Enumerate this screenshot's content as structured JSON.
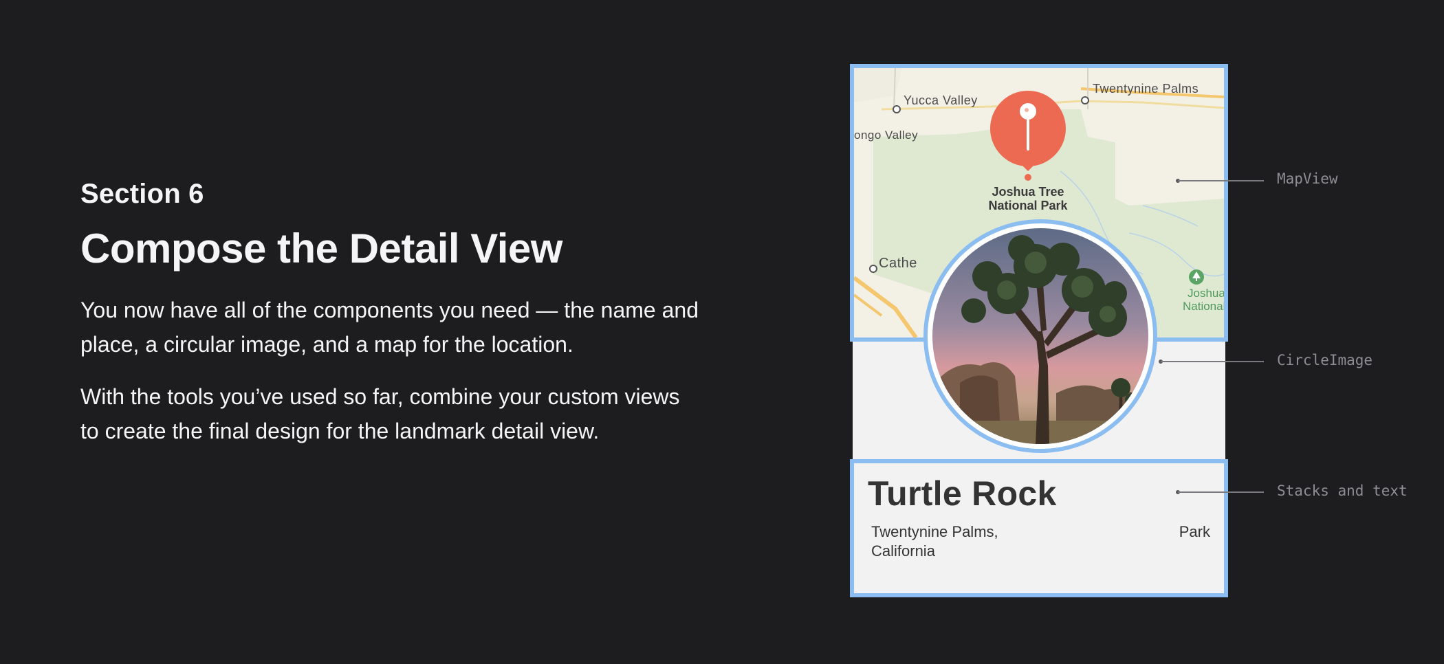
{
  "intro": {
    "section": "Section 6",
    "title": "Compose the Detail View",
    "paragraph_1": "You now have all of the components you need — the name and place, a circular image, and a map for the location.",
    "paragraph_2": "With the tools you’ve used so far, combine your custom views to create the final design for the landmark detail view."
  },
  "map": {
    "labels": {
      "yucca_valley": "Yucca Valley",
      "twentynine_palms": "Twentynine Palms",
      "morongo_valley": "ongo Valley",
      "cathedral": "Cathe",
      "park_line_1": "Joshua Tree",
      "park_line_2": "National Park",
      "park_small_line_1": "Joshua Tre",
      "park_small_line_2": "National Pa"
    },
    "icons": {
      "pin": "map-pin-icon",
      "park": "tree-icon"
    },
    "colors": {
      "pin": "#ec6a52",
      "park_green": "#dfe9d2",
      "land": "#f3f0e6",
      "road": "#f4c66d",
      "park_text": "#4e9a5c"
    }
  },
  "detail": {
    "name": "Turtle Rock",
    "location": "Twentynine Palms, California",
    "park_type": "Park"
  },
  "callouts": {
    "map": "MapView",
    "circle": "CircleImage",
    "stacks": "Stacks and text"
  },
  "colors": {
    "background": "#1d1d1f",
    "highlight": "#8bbdf0",
    "callout_text": "#8e8e93",
    "card_background": "#f2f2f2"
  }
}
